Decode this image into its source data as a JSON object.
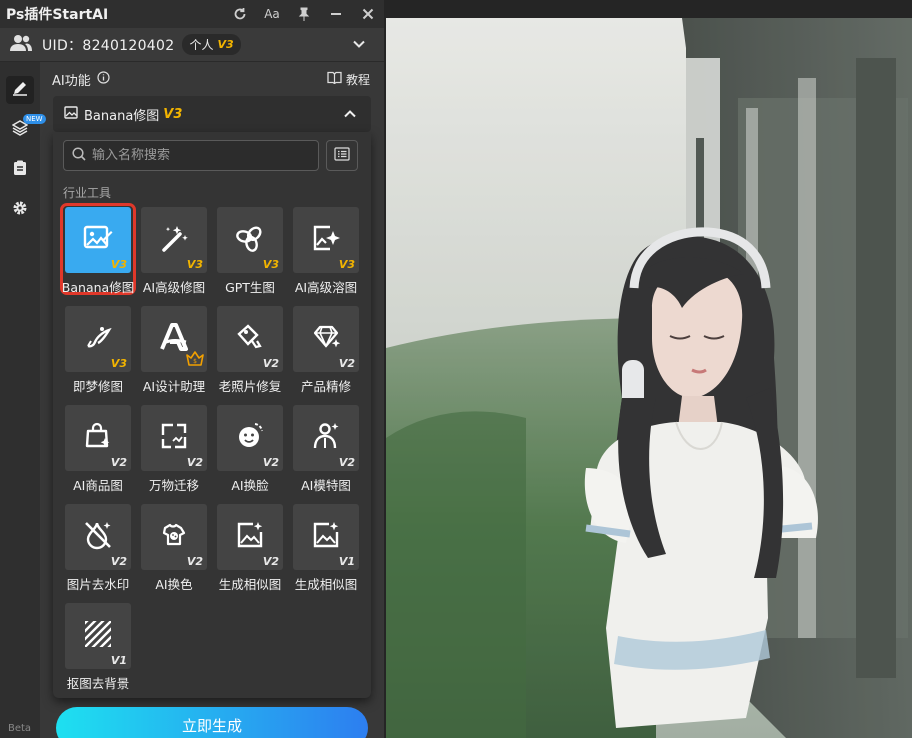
{
  "window": {
    "title": "Ps插件StartAI",
    "font_btn_label": "Aa"
  },
  "user": {
    "uid_label": "UID：8240120402",
    "plan_label": "个人",
    "plan_level": "V3"
  },
  "rail": {
    "new_badge": "NEW",
    "beta_label": "Beta"
  },
  "ai_section": {
    "label": "AI功能",
    "tutorial_label": "教程"
  },
  "selected_tool": {
    "name": "Banana修图",
    "level": "V3"
  },
  "search": {
    "placeholder": "输入名称搜索"
  },
  "category_label": "行业工具",
  "tools": [
    {
      "name": "Banana修图",
      "level": "V3",
      "icon": "image-edit-icon",
      "selected": true
    },
    {
      "name": "AI高级修图",
      "level": "V3",
      "icon": "magic-wand-icon"
    },
    {
      "name": "GPT生图",
      "level": "V3",
      "icon": "gpt-knot-icon"
    },
    {
      "name": "AI高级溶图",
      "level": "V3",
      "icon": "image-sparkle-icon"
    },
    {
      "name": "即梦修图",
      "level": "V3",
      "icon": "dream-brush-icon"
    },
    {
      "name": "AI设计助理",
      "level": "",
      "icon": "design-a-icon",
      "badge": "crown-icon"
    },
    {
      "name": "老照片修复",
      "level": "V2",
      "icon": "photo-repair-icon"
    },
    {
      "name": "产品精修",
      "level": "V2",
      "icon": "diamond-icon"
    },
    {
      "name": "AI商品图",
      "level": "V2",
      "icon": "shopping-bag-icon"
    },
    {
      "name": "万物迁移",
      "level": "V2",
      "icon": "transfer-icon"
    },
    {
      "name": "AI换脸",
      "level": "V2",
      "icon": "face-swap-icon"
    },
    {
      "name": "AI模特图",
      "level": "V2",
      "icon": "model-person-icon"
    },
    {
      "name": "图片去水印",
      "level": "V2",
      "icon": "remove-watermark-icon"
    },
    {
      "name": "AI换色",
      "level": "V2",
      "icon": "color-change-icon"
    },
    {
      "name": "生成相似图",
      "level": "V2",
      "icon": "similar-image-icon"
    },
    {
      "name": "生成相似图",
      "level": "V1",
      "icon": "similar-image-icon"
    },
    {
      "name": "抠图去背景",
      "level": "V1",
      "icon": "cutout-icon"
    }
  ],
  "generate_button": "立即生成",
  "colors": {
    "accent_gold": "#f2b400",
    "selection_blue": "#39aaf0",
    "selection_border": "#e0382a",
    "button_gradient_start": "#1ee0f0",
    "button_gradient_end": "#2d7ef0"
  }
}
